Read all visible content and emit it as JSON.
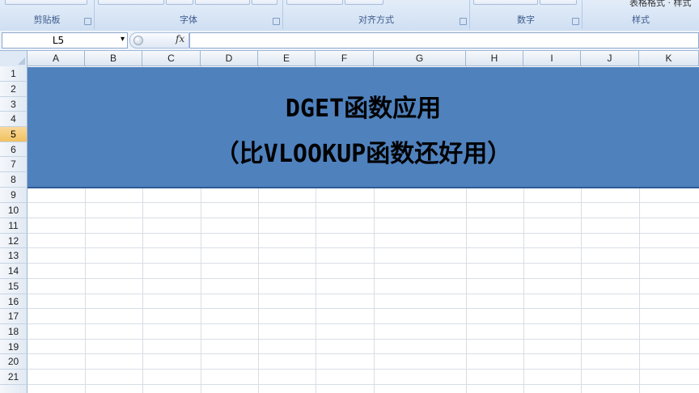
{
  "ribbon": {
    "groups": [
      {
        "label": "剪贴板"
      },
      {
        "label": "字体"
      },
      {
        "label": "对齐方式"
      },
      {
        "label": "数字"
      },
      {
        "label": "样式"
      }
    ],
    "style_gallery_text": "表格格式 · 样式"
  },
  "formula_bar": {
    "name_box": "L5",
    "name_box_arrow": "▾",
    "fx_label": "fx",
    "formula": ""
  },
  "sheet": {
    "columns": [
      "A",
      "B",
      "C",
      "D",
      "E",
      "F",
      "G",
      "H",
      "I",
      "J",
      "K"
    ],
    "rows": [
      "1",
      "2",
      "3",
      "4",
      "5",
      "6",
      "7",
      "8",
      "9",
      "10",
      "11",
      "12",
      "13",
      "14",
      "15",
      "16",
      "17",
      "18",
      "19",
      "20",
      "21"
    ],
    "selected_row": "5",
    "banner": {
      "line1": "DGET函数应用",
      "line2": "（比VLOOKUP函数还好用）",
      "fill_color": "#4f81bd"
    }
  }
}
